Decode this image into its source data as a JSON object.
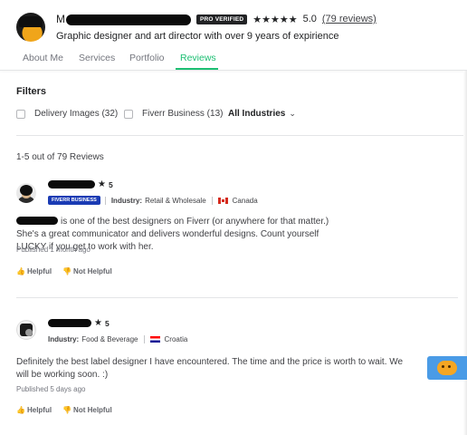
{
  "seller": {
    "name_initial": "M",
    "pro_badge": "PRO VERIFIED",
    "stars": "★★★★★",
    "rating": "5.0",
    "reviews_link": "(79 reviews)",
    "tagline": "Graphic designer and art director with over 9 years of expirience"
  },
  "tabs": [
    "About Me",
    "Services",
    "Portfolio",
    "Reviews"
  ],
  "filters": {
    "title": "Filters",
    "options": [
      "Delivery Images (32)",
      "Fiverr Business (13)"
    ],
    "industries": "All Industries",
    "chevron": "⌄"
  },
  "count_text": "1-5 out of 79 Reviews",
  "reviews": [
    {
      "star": "★",
      "score": "5",
      "badge": "FIVERR BUSINESS",
      "industry_label": "Industry:",
      "industry": "Retail & Wholesale",
      "country": "Canada",
      "text": "is one of the best designers on Fiverr (or anywhere for that matter.) She's a great communicator and delivers wonderful designs. Count yourself LUCKY if you get to work with her.",
      "published": "Published 1 month ago",
      "helpful": "Helpful",
      "not_helpful": "Not Helpful"
    },
    {
      "star": "★",
      "score": "5",
      "industry_label": "Industry:",
      "industry": "Food & Beverage",
      "country": "Croatia",
      "text": "Definitely the best label designer I have encountered. The time and the price is worth to wait. We will be working soon. :)",
      "published": "Published 5 days ago",
      "helpful": "Helpful",
      "not_helpful": "Not Helpful"
    }
  ],
  "icons": {
    "thumb_up": "👍",
    "thumb_down": "👎"
  },
  "colors": {
    "accent": "#1dbf73",
    "business_badge": "#1a3bb4",
    "pro_badge": "#222325"
  }
}
